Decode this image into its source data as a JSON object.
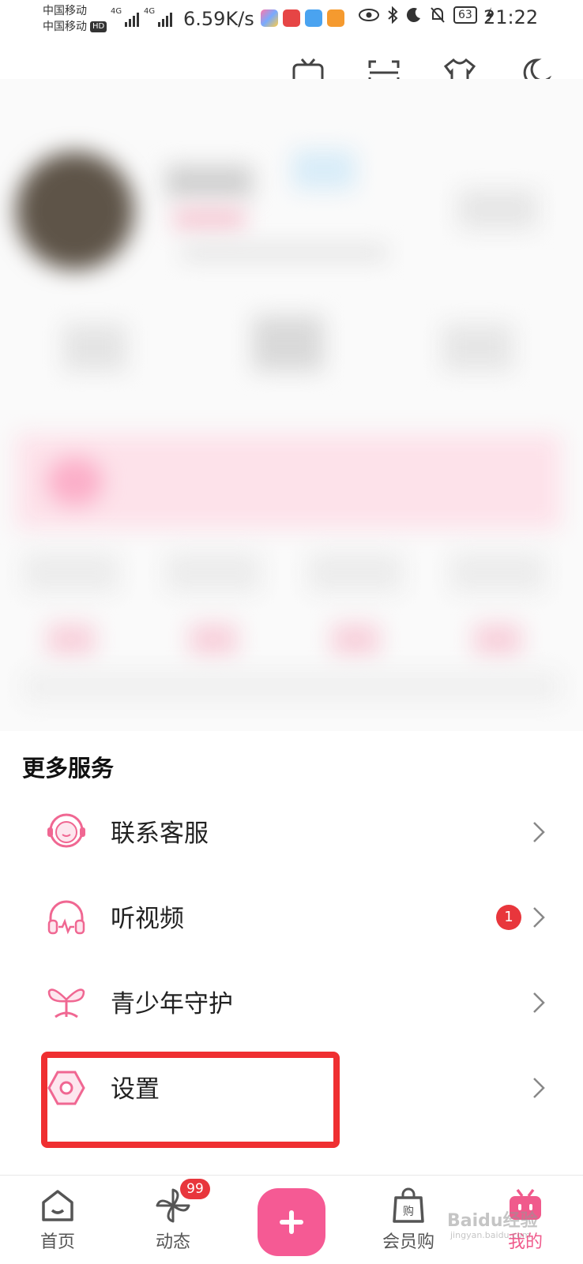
{
  "status_bar": {
    "carrier_1": "中国移动",
    "carrier_2": "中国移动",
    "hd": "HD",
    "net_1": "4G",
    "net_2": "4G",
    "speed": "6.59K/s",
    "battery": "63",
    "time": "21:22"
  },
  "top_icons": [
    "tv-icon",
    "scan-icon",
    "shirt-icon",
    "moon-icon"
  ],
  "more_services": {
    "title": "更多服务",
    "items": [
      {
        "label": "联系客服",
        "icon": "headset-icon"
      },
      {
        "label": "听视频",
        "icon": "headphones-icon",
        "badge": "1"
      },
      {
        "label": "青少年守护",
        "icon": "sprout-icon"
      },
      {
        "label": "设置",
        "icon": "settings-icon"
      }
    ]
  },
  "bottom_nav": {
    "items": [
      {
        "label": "首页",
        "icon": "home-icon"
      },
      {
        "label": "动态",
        "icon": "pinwheel-icon",
        "badge": "99"
      },
      {
        "label": "会员购",
        "icon": "shopping-bag-icon"
      },
      {
        "label": "我的",
        "icon": "tv-face-icon",
        "active": true
      }
    ],
    "add_icon": "plus-icon"
  },
  "colors": {
    "accent": "#f05a8c",
    "badge": "#e8363c",
    "highlight_box": "#ef2f31"
  },
  "watermark": {
    "text": "Baidu经验",
    "sub": "jingyan.baidu.com"
  }
}
